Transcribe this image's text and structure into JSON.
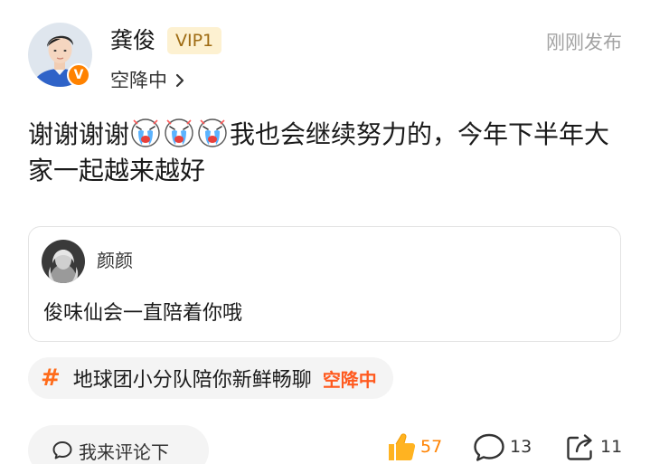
{
  "header": {
    "username": "龚俊",
    "vip_label": "VIP1",
    "timestamp": "刚刚发布",
    "topic_link": "空降中",
    "avatar_icon": "user-avatar",
    "verified_icon": "verified-v-badge",
    "verified_letter": "V"
  },
  "post": {
    "text_before": "谢谢谢谢",
    "emojis": [
      "crying-emoji",
      "crying-emoji",
      "crying-emoji"
    ],
    "text_after": "我也会继续努力的，今年下半年大家一起越来越好"
  },
  "quote": {
    "name": "颜颜",
    "text": "俊味仙会一直陪着你哦"
  },
  "topic_tag": {
    "hash": "#",
    "label": "地球团小分队陪你新鲜畅聊",
    "accent": "空降中"
  },
  "footer": {
    "comment_placeholder": "我来评论下",
    "likes": "57",
    "comments": "13",
    "shares": "11"
  },
  "colors": {
    "accent_orange": "#ff8200",
    "vip_bg": "#fdf1d1",
    "vip_text": "#9e6b12",
    "tag_accent": "#ff5a1f"
  }
}
